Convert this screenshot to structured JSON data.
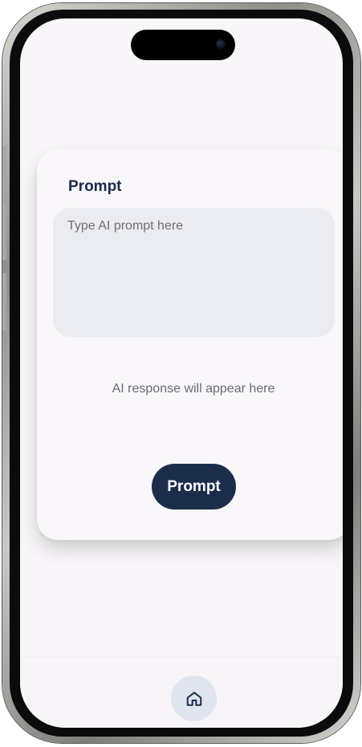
{
  "card": {
    "title": "Prompt",
    "input_placeholder": "Type AI prompt here",
    "input_value": "",
    "response_placeholder": "AI response will appear here",
    "submit_label": "Prompt"
  },
  "bottom_nav": {
    "home_icon": "home-icon"
  },
  "colors": {
    "accent": "#1c2d4c",
    "input_bg": "#ebecf1",
    "screen_bg": "#f8f6f8",
    "home_button_bg": "#dfe4ee"
  }
}
